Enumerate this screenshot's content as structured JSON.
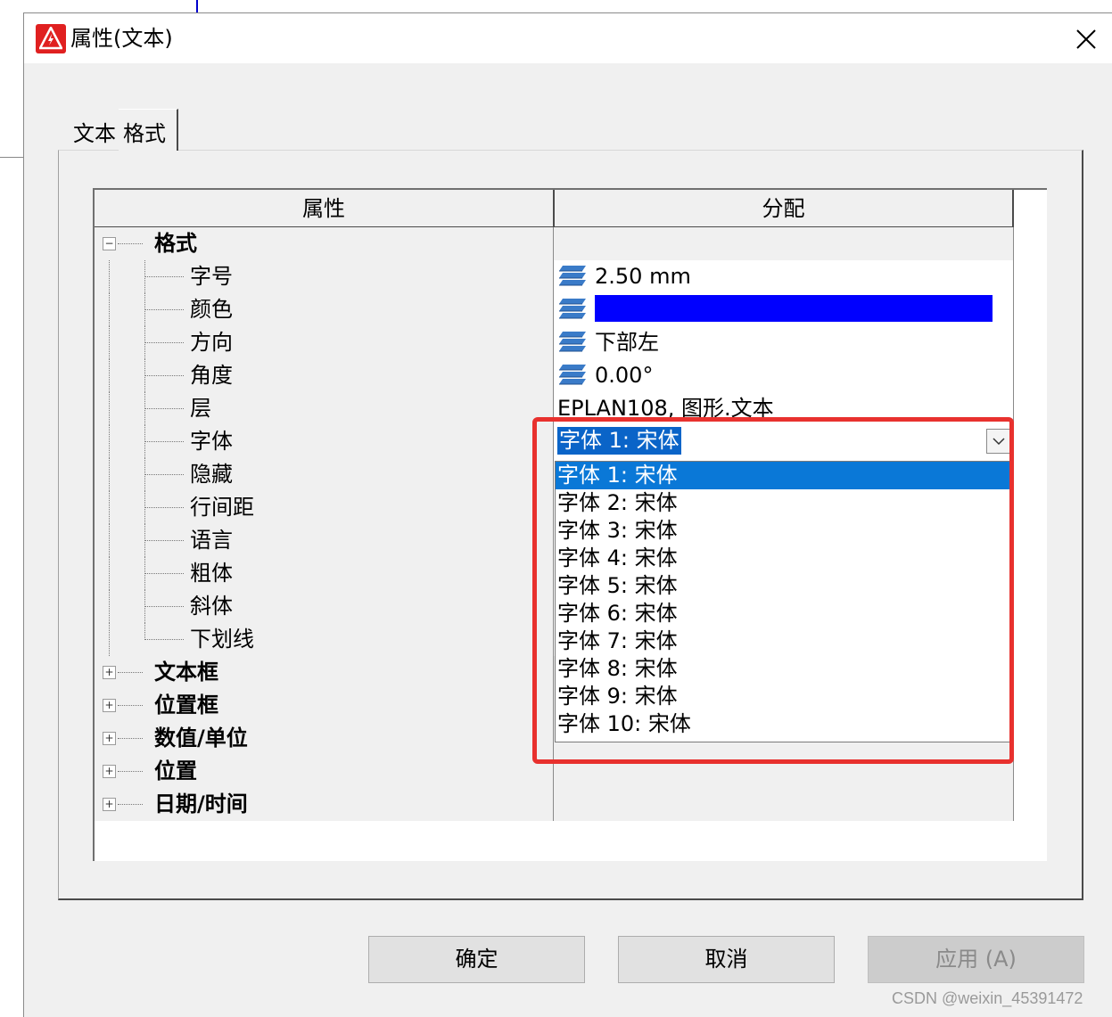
{
  "dialog": {
    "title": "属性(文本)",
    "tabs": [
      {
        "label": "文本"
      },
      {
        "label": "格式"
      }
    ],
    "active_tab": "格式"
  },
  "grid": {
    "columns": {
      "property": "属性",
      "value": "分配"
    },
    "rows": [
      {
        "label": "格式",
        "group": true,
        "expanded": true,
        "value": ""
      },
      {
        "label": "字号",
        "value": "2.50 mm",
        "icon": "layer-stack-icon"
      },
      {
        "label": "颜色",
        "value_color": "#0000ff",
        "icon": "layer-stack-icon"
      },
      {
        "label": "方向",
        "value": "下部左",
        "icon": "layer-stack-icon"
      },
      {
        "label": "角度",
        "value": "0.00°",
        "icon": "layer-stack-icon"
      },
      {
        "label": "层",
        "value": "EPLAN108, 图形.文本"
      },
      {
        "label": "字体",
        "value": "字体 1: 宋体",
        "combo": true
      },
      {
        "label": "隐藏",
        "value": ""
      },
      {
        "label": "行间距",
        "value": ""
      },
      {
        "label": "语言",
        "value": ""
      },
      {
        "label": "粗体",
        "value": ""
      },
      {
        "label": "斜体",
        "value": ""
      },
      {
        "label": "下划线",
        "value": ""
      },
      {
        "label": "文本框",
        "group": true,
        "expanded": false,
        "value": ""
      },
      {
        "label": "位置框",
        "group": true,
        "expanded": false,
        "value": ""
      },
      {
        "label": "数值/单位",
        "group": true,
        "expanded": false,
        "value": ""
      },
      {
        "label": "位置",
        "group": true,
        "expanded": false,
        "value": ""
      },
      {
        "label": "日期/时间",
        "group": true,
        "expanded": false,
        "value": ""
      }
    ]
  },
  "font_dropdown": {
    "selected": "字体 1: 宋体",
    "options": [
      "字体 1: 宋体",
      "字体 2: 宋体",
      "字体 3: 宋体",
      "字体 4: 宋体",
      "字体 5: 宋体",
      "字体 6: 宋体",
      "字体 7: 宋体",
      "字体 8: 宋体",
      "字体 9: 宋体",
      "字体 10: 宋体"
    ],
    "highlight_color": "#e8312e"
  },
  "buttons": {
    "ok": "确定",
    "cancel": "取消",
    "apply": "应用 (A)"
  },
  "watermark": "CSDN @weixin_45391472",
  "colors": {
    "accent": "#0a78d7",
    "swatch": "#0000ff",
    "brand_icon": "#e02020"
  }
}
